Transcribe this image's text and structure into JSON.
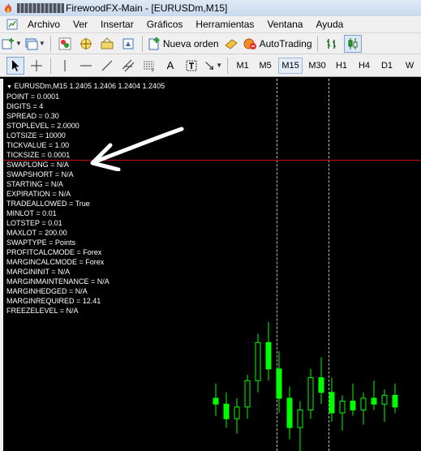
{
  "window": {
    "title": "FirewoodFX-Main - [EURUSDm,M15]"
  },
  "menu": [
    "Archivo",
    "Ver",
    "Insertar",
    "Gráficos",
    "Herramientas",
    "Ventana",
    "Ayuda"
  ],
  "toolbar": {
    "new_order_label": "Nueva orden",
    "autotrading_label": "AutoTrading",
    "text_tool_label": "A"
  },
  "timeframes": [
    "M1",
    "M5",
    "M15",
    "M30",
    "H1",
    "H4",
    "D1",
    "W"
  ],
  "active_timeframe": "M15",
  "chart": {
    "header": "EURUSDm,M15  1.2405 1.2406 1.2404 1.2405",
    "info_lines": [
      "POINT = 0.0001",
      "DIGITS = 4",
      "SPREAD = 0.30",
      "STOPLEVEL = 2.0000",
      "LOTSIZE = 10000",
      "TICKVALUE = 1.00",
      "TICKSIZE = 0.0001",
      "SWAPLONG = N/A",
      "SWAPSHORT = N/A",
      "STARTING = N/A",
      "EXPIRATION = N/A",
      "TRADEALLOWED = True",
      "MINLOT = 0.01",
      "LOTSTEP = 0.01",
      "MAXLOT = 200.00",
      "SWAPTYPE = Points",
      "PROFITCALCMODE = Forex",
      "MARGINCALCMODE = Forex",
      "MARGININIT = N/A",
      "MARGINMAINTENANCE = N/A",
      "MARGINHEDGED = N/A",
      "MARGINREQUIRED = 12.41",
      "FREEZELEVEL = N/A"
    ],
    "colors": {
      "background": "#000000",
      "text": "#ffffff",
      "bull_candle": "#00ff00",
      "bear_candle": "#000000",
      "bid_line": "#c0101a"
    }
  },
  "candles": [
    {
      "o": 1.239,
      "h": 1.2395,
      "l": 1.2384,
      "c": 1.2388
    },
    {
      "o": 1.2388,
      "h": 1.2392,
      "l": 1.238,
      "c": 1.2383
    },
    {
      "o": 1.2383,
      "h": 1.239,
      "l": 1.2378,
      "c": 1.2387
    },
    {
      "o": 1.2387,
      "h": 1.2398,
      "l": 1.2383,
      "c": 1.2396
    },
    {
      "o": 1.2396,
      "h": 1.2412,
      "l": 1.2392,
      "c": 1.2409
    },
    {
      "o": 1.2409,
      "h": 1.2416,
      "l": 1.2396,
      "c": 1.24
    },
    {
      "o": 1.24,
      "h": 1.2406,
      "l": 1.2385,
      "c": 1.239
    },
    {
      "o": 1.239,
      "h": 1.2394,
      "l": 1.2376,
      "c": 1.238
    },
    {
      "o": 1.238,
      "h": 1.2389,
      "l": 1.2372,
      "c": 1.2386
    },
    {
      "o": 1.2386,
      "h": 1.24,
      "l": 1.2383,
      "c": 1.2397
    },
    {
      "o": 1.2397,
      "h": 1.2404,
      "l": 1.2388,
      "c": 1.2392
    },
    {
      "o": 1.2392,
      "h": 1.2397,
      "l": 1.2382,
      "c": 1.2385
    },
    {
      "o": 1.2385,
      "h": 1.2391,
      "l": 1.2379,
      "c": 1.2389
    },
    {
      "o": 1.2389,
      "h": 1.2395,
      "l": 1.2384,
      "c": 1.2386
    },
    {
      "o": 1.2386,
      "h": 1.2392,
      "l": 1.2381,
      "c": 1.239
    },
    {
      "o": 1.239,
      "h": 1.2396,
      "l": 1.2386,
      "c": 1.2388
    },
    {
      "o": 1.2388,
      "h": 1.2393,
      "l": 1.2382,
      "c": 1.2391
    },
    {
      "o": 1.2391,
      "h": 1.2395,
      "l": 1.2385,
      "c": 1.2387
    }
  ]
}
